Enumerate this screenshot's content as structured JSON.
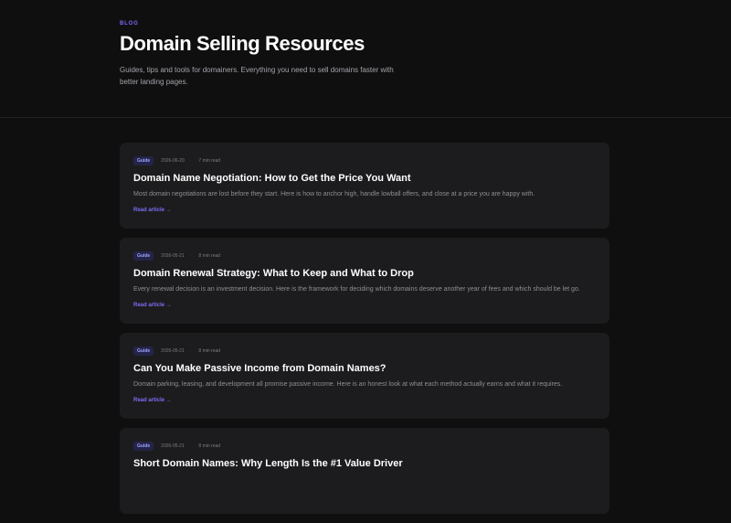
{
  "header": {
    "eyebrow": "BLOG",
    "title": "Domain Selling Resources",
    "subtitle": "Guides, tips and tools for domainers. Everything you need to sell domains faster with better landing pages."
  },
  "posts": [
    {
      "badge": "Guide",
      "date": "2026-06-20",
      "read_time": "7 min read",
      "title": "Domain Name Negotiation: How to Get the Price You Want",
      "excerpt": "Most domain negotiations are lost before they start. Here is how to anchor high, handle lowball offers, and close at a price you are happy with.",
      "link": "Read article →"
    },
    {
      "badge": "Guide",
      "date": "2026-05-21",
      "read_time": "8 min read",
      "title": "Domain Renewal Strategy: What to Keep and What to Drop",
      "excerpt": "Every renewal decision is an investment decision. Here is the framework for deciding which domains deserve another year of fees and which should be let go.",
      "link": "Read article →"
    },
    {
      "badge": "Guide",
      "date": "2026-05-21",
      "read_time": "8 min read",
      "title": "Can You Make Passive Income from Domain Names?",
      "excerpt": "Domain parking, leasing, and development all promise passive income. Here is an honest look at what each method actually earns and what it requires.",
      "link": "Read article →"
    },
    {
      "badge": "Guide",
      "date": "2026-05-21",
      "read_time": "8 min read",
      "title": "Short Domain Names: Why Length Is the #1 Value Driver",
      "excerpt": "",
      "link": ""
    }
  ]
}
